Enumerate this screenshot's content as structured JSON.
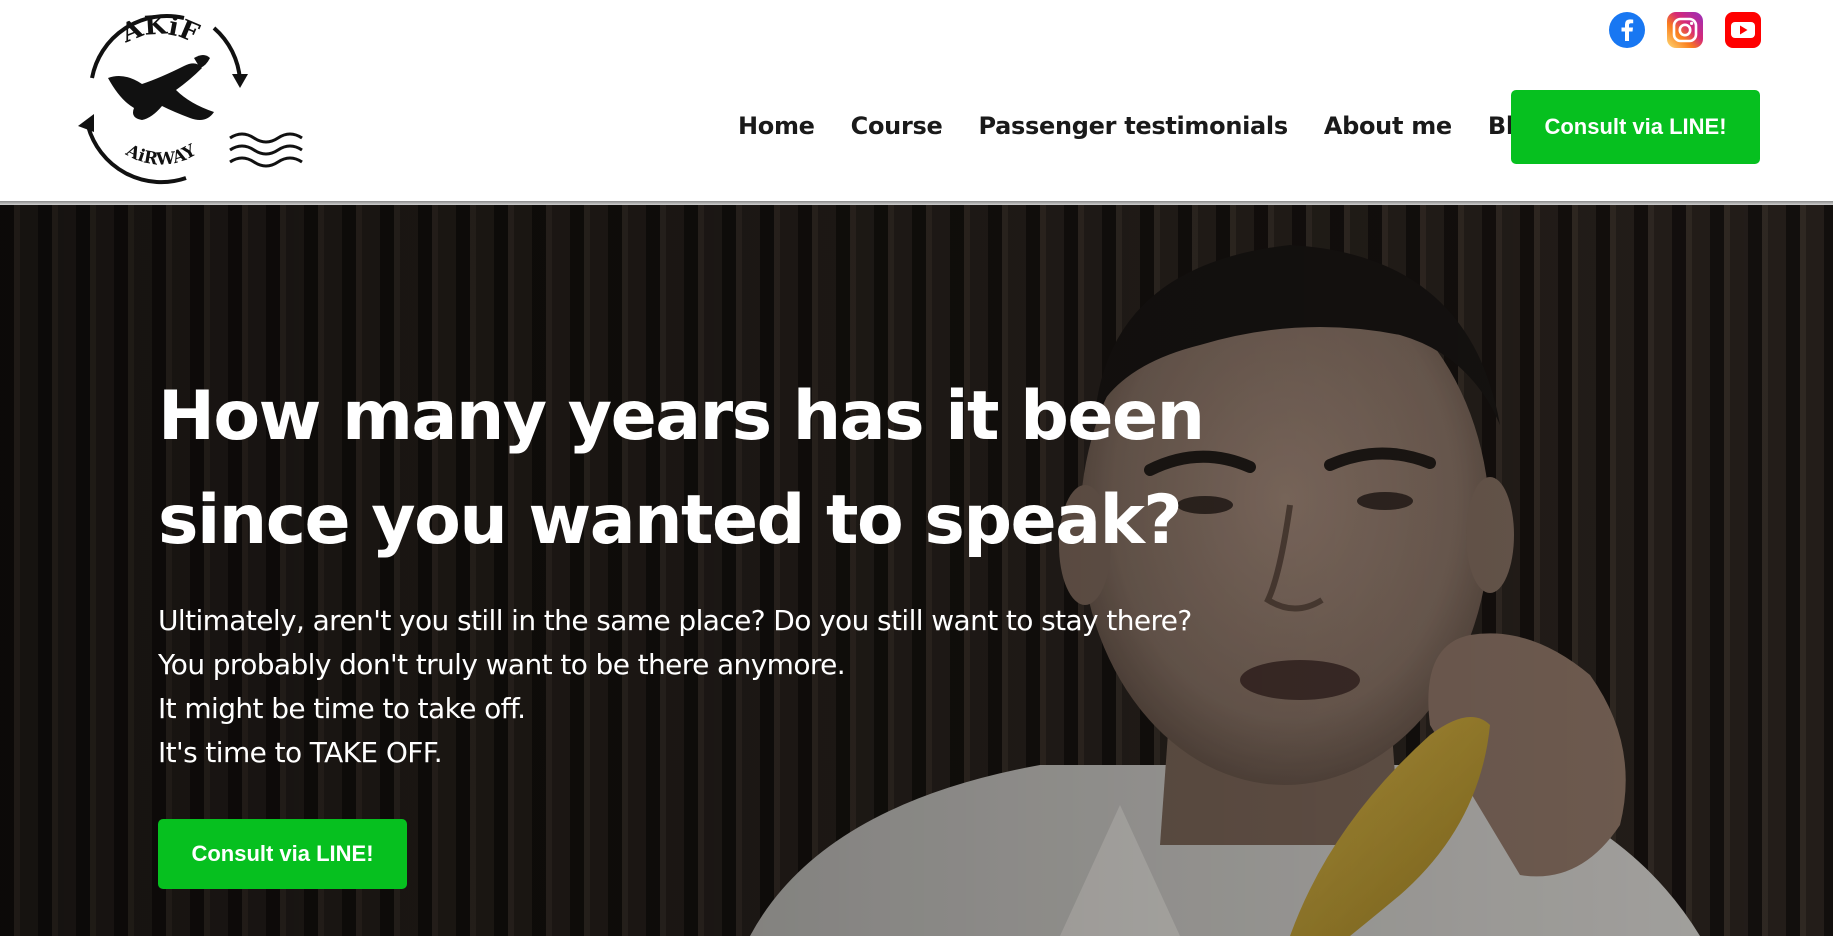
{
  "brand": {
    "logo_top_text": "AKiF",
    "logo_bottom_text": "AiRWAY",
    "icon": "airplane-banana-logo"
  },
  "social": [
    {
      "name": "facebook",
      "icon": "facebook-icon",
      "color": "#1877f2"
    },
    {
      "name": "instagram",
      "icon": "instagram-icon",
      "color": "#e1306c"
    },
    {
      "name": "youtube",
      "icon": "youtube-icon",
      "color": "#ff0000"
    }
  ],
  "nav": {
    "items": [
      {
        "label": "Home"
      },
      {
        "label": "Course"
      },
      {
        "label": "Passenger testimonials"
      },
      {
        "label": "About me"
      },
      {
        "label": "Blog"
      }
    ],
    "cta_label": "Consult via LINE!"
  },
  "hero": {
    "title_line1": "How many years has it been",
    "title_line2": "since you wanted to speak?",
    "lines": [
      "Ultimately, aren't you still in the same place? Do you still want to stay there?",
      "You probably don't truly want to be there anymore.",
      "It might be time to take off.",
      "It's time to TAKE OFF."
    ],
    "cta_label": "Consult via LINE!"
  },
  "colors": {
    "cta_green": "#06c01f",
    "nav_text": "#1a1a1a",
    "hero_text": "#ffffff"
  }
}
